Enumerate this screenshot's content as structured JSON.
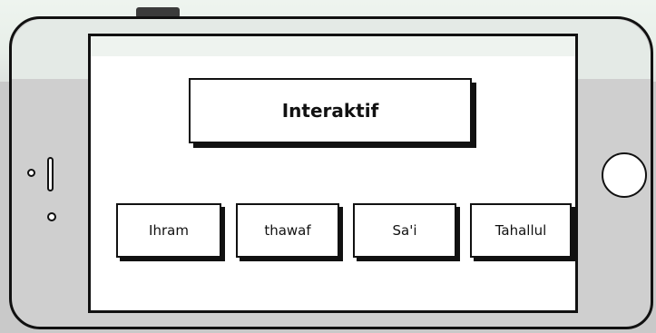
{
  "screen": {
    "title": "Interaktif",
    "buttons": [
      {
        "label": "Ihram"
      },
      {
        "label": "thawaf"
      },
      {
        "label": "Sa'i"
      },
      {
        "label": "Tahallul"
      }
    ]
  },
  "colors": {
    "outline": "#111111",
    "device_body": "#cfcfcf",
    "screen_background": "#ffffff",
    "top_tint": "#eef4ef"
  }
}
